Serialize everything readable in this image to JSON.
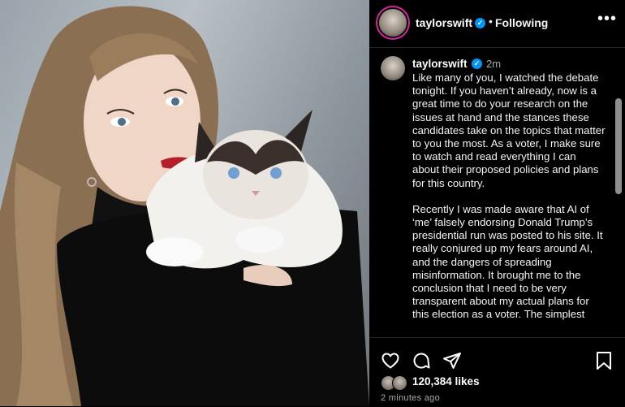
{
  "header": {
    "username": "taylorswift",
    "separator": "•",
    "follow_status": "Following",
    "more_label": "•••"
  },
  "post": {
    "username": "taylorswift",
    "time": "2m",
    "caption": [
      "Like many of you, I watched the debate tonight. If you haven’t already, now is a great time to do your research on the issues at hand and the stances these candidates take on the topics that matter to you the most. As a voter, I make sure to watch and read everything I can about their proposed policies and plans for this country.",
      "Recently I was made aware that AI of ‘me’ falsely endorsing Donald Trump’s presidential run was posted to his site. It really conjured up my fears around AI, and the dangers of spreading misinformation. It brought me to the conclusion that I need to be very transparent about my actual plans for this election as a voter. The simplest"
    ]
  },
  "footer": {
    "likes": "120,384 likes",
    "timestamp": "2 minutes ago"
  },
  "icons": {
    "like": "heart-icon",
    "comment": "comment-icon",
    "share": "share-icon",
    "save": "bookmark-icon",
    "verified": "verified-badge-icon"
  },
  "colors": {
    "verified": "#0095f6",
    "background": "#000000",
    "secondary_text": "#a8a8a8"
  }
}
